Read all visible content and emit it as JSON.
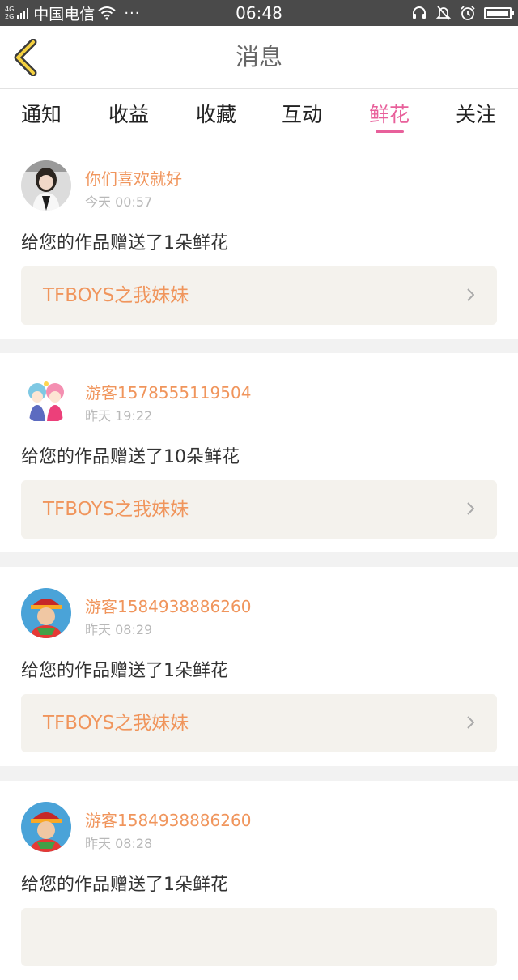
{
  "status_bar": {
    "net_top": "4G",
    "net_bottom": "2G",
    "carrier": "中国电信",
    "more": "···",
    "time": "06:48",
    "icons": [
      "headset-icon",
      "bell-off-icon",
      "alarm-icon",
      "battery-icon"
    ]
  },
  "header": {
    "title": "消息",
    "back_icon": "chevron-left-icon"
  },
  "tabs": [
    {
      "label": "通知",
      "active": false
    },
    {
      "label": "收益",
      "active": false
    },
    {
      "label": "收藏",
      "active": false
    },
    {
      "label": "互动",
      "active": false
    },
    {
      "label": "鲜花",
      "active": true
    },
    {
      "label": "关注",
      "active": false
    }
  ],
  "colors": {
    "accent": "#e8609b",
    "username": "#f0955c",
    "card_link_bg": "#f4f2ed"
  },
  "messages": [
    {
      "username": "你们喜欢就好",
      "time": "今天 00:57",
      "text": "给您的作品赠送了1朵鲜花",
      "work_title": "TFBOYS之我妹妹"
    },
    {
      "username": "游客1578555119504",
      "time": "昨天 19:22",
      "text": "给您的作品赠送了10朵鲜花",
      "work_title": "TFBOYS之我妹妹"
    },
    {
      "username": "游客1584938886260",
      "time": "昨天 08:29",
      "text": "给您的作品赠送了1朵鲜花",
      "work_title": "TFBOYS之我妹妹"
    },
    {
      "username": "游客1584938886260",
      "time": "昨天 08:28",
      "text": "给您的作品赠送了1朵鲜花",
      "work_title": ""
    }
  ]
}
